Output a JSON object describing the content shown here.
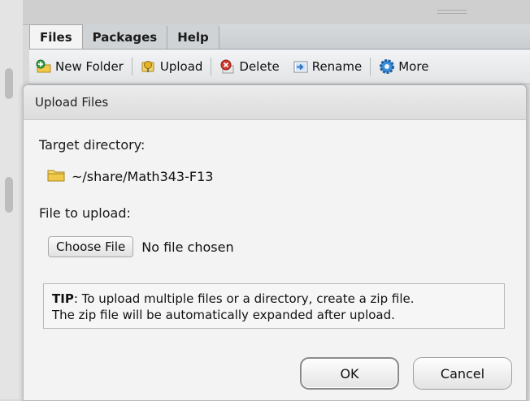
{
  "tabs": [
    {
      "label": "Files",
      "active": true
    },
    {
      "label": "Packages",
      "active": false
    },
    {
      "label": "Help",
      "active": false
    }
  ],
  "toolbar": {
    "new_folder": "New Folder",
    "upload": "Upload",
    "delete": "Delete",
    "rename": "Rename",
    "more": "More"
  },
  "dialog": {
    "title": "Upload Files",
    "target_label": "Target directory:",
    "target_path": "~/share/Math343-F13",
    "file_label": "File to upload:",
    "choose_button": "Choose File",
    "no_file": "No file chosen",
    "tip_prefix": "TIP",
    "tip_line1": ": To upload multiple files or a directory, create a zip file.",
    "tip_line2": "The zip file will be automatically expanded after upload.",
    "ok_label": "OK",
    "cancel_label": "Cancel"
  },
  "colors": {
    "folder_yellow": "#f2c84b",
    "delete_red": "#d23b2e",
    "upload_yellow": "#e6b422",
    "rename_blue": "#2f73c9",
    "gear_blue": "#3b8ed8",
    "green_plus": "#3aa34a"
  }
}
